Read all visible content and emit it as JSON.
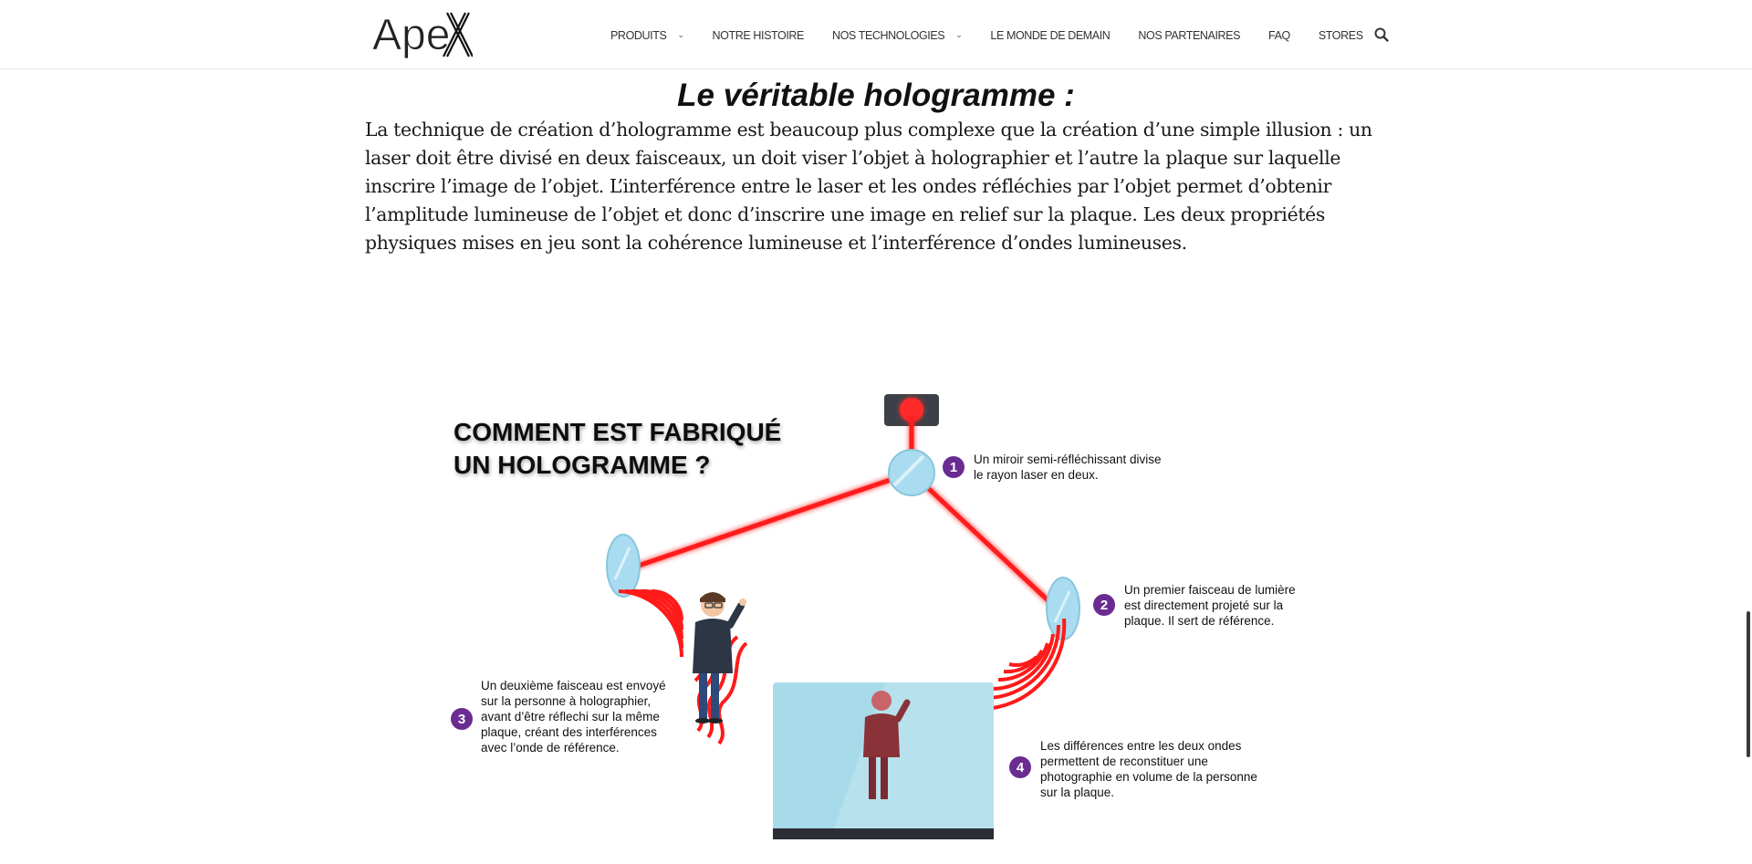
{
  "header": {
    "logo": {
      "text": "Ape",
      "aria": "Apex logo"
    },
    "nav": [
      {
        "label": "PRODUITS",
        "has_dropdown": true
      },
      {
        "label": "NOTRE HISTOIRE",
        "has_dropdown": false
      },
      {
        "label": "NOS TECHNOLOGIES",
        "has_dropdown": true
      },
      {
        "label": "LE MONDE DE DEMAIN",
        "has_dropdown": false
      },
      {
        "label": "NOS PARTENAIRES",
        "has_dropdown": false
      },
      {
        "label": "FAQ",
        "has_dropdown": false
      },
      {
        "label": "STORES",
        "has_dropdown": false
      }
    ],
    "search_icon": "search-icon"
  },
  "article": {
    "title": "Le véritable hologramme :",
    "paragraph": "La technique de création d’hologramme est beaucoup plus complexe que la création d’une simple illusion : un laser doit être divisé en deux faisceaux, un doit viser l’objet à holographier et l’autre la plaque sur laquelle inscrire l’image de l’objet. L’interférence entre le laser et les ondes réfléchies par l’objet permet d’obtenir l’amplitude lumineuse de l’objet et donc d’inscrire une image en relief sur la plaque. Les deux propriétés physiques mises en jeu sont la cohérence lumineuse et l’interférence d’ondes lumineuses."
  },
  "illustration": {
    "heading_line1": "COMMENT EST FABRIQUÉ",
    "heading_line2": "UN HOLOGRAMME ?",
    "steps": [
      {
        "number": "1",
        "lines": [
          "Un miroir semi-réfléchissant divise",
          "le rayon laser en deux."
        ]
      },
      {
        "number": "2",
        "lines": [
          "Un premier faisceau de lumière",
          "est directement projeté sur la",
          "plaque. Il sert de référence."
        ]
      },
      {
        "number": "3",
        "lines": [
          "Un deuxième faisceau est envoyé",
          "sur la personne à holographier,",
          "avant d’être réflechi sur la même",
          "plaque, créant des interférences",
          "avec l’onde de référence."
        ]
      },
      {
        "number": "4",
        "lines": [
          "Les différences entre les deux ondes",
          "permettent de reconstituer une",
          "photographie en volume de la personne",
          "sur la plaque."
        ]
      }
    ],
    "colors": {
      "laser": "#ff1a1a",
      "mirror": "#a9dcf0",
      "step_badge": "#6a2c91",
      "plate": "#a8dbea"
    }
  }
}
